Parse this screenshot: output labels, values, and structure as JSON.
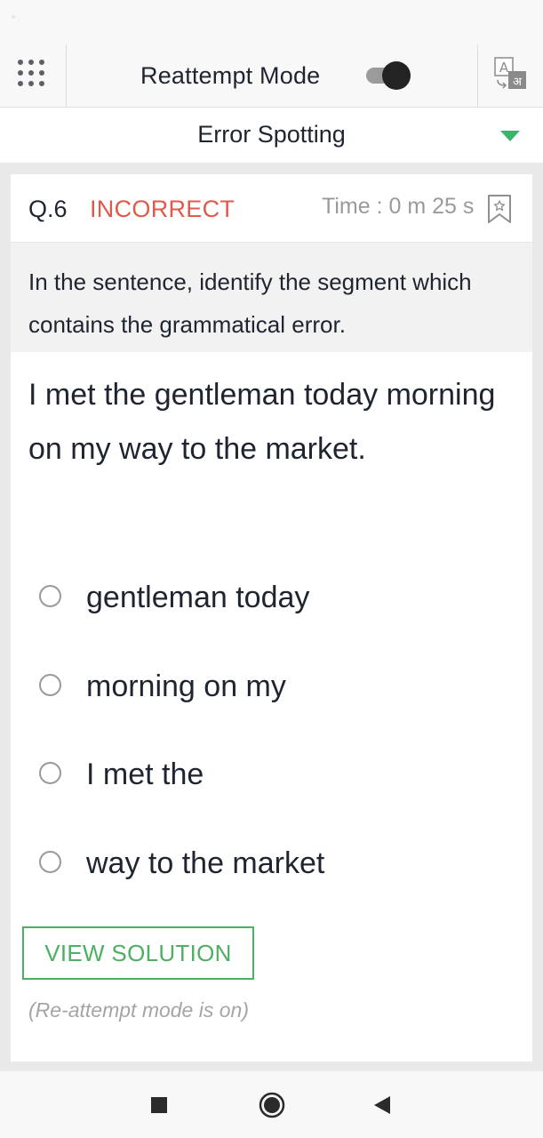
{
  "header": {
    "mode_title": "Reattempt Mode",
    "reattempt_toggle": "on",
    "grid_icon": "grid-menu-icon",
    "language_icon": "translate-icon"
  },
  "section": {
    "selected": "Error Spotting",
    "dropdown_icon": "dropdown-arrow-icon",
    "accent_color": "#3bb36a"
  },
  "question": {
    "number": "Q.6",
    "status": "INCORRECT",
    "status_color": "#e05a4c",
    "time": "Time : 0 m 25 s",
    "bookmark_icon": "bookmark-icon",
    "instruction": "In the sentence, identify the segment which contains the grammatical error.",
    "text": "I met the gentleman today morning on my way to the market.",
    "options": [
      {
        "label": "gentleman today"
      },
      {
        "label": "morning on my"
      },
      {
        "label": "I met the"
      },
      {
        "label": "way to the market"
      }
    ]
  },
  "actions": {
    "view_solution": "VIEW SOLUTION",
    "button_color": "#4caf62",
    "note": "(Re-attempt mode is on)"
  },
  "navbar": {
    "recents_icon": "square-icon",
    "home_icon": "circle-icon",
    "back_icon": "back-triangle-icon"
  }
}
